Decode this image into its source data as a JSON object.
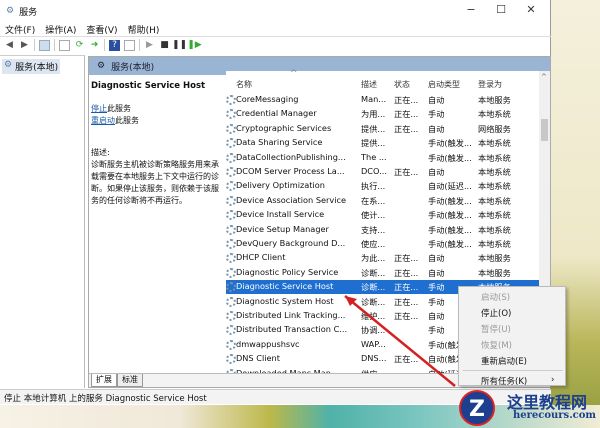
{
  "window": {
    "title": "服务",
    "minimize": "−",
    "maximize": "☐",
    "close": "✕"
  },
  "menu": [
    "文件(F)",
    "操作(A)",
    "查看(V)",
    "帮助(H)"
  ],
  "toolbar_icons": [
    "back-icon",
    "forward-icon",
    "console-tree-icon",
    "properties-icon",
    "refresh-icon",
    "export-icon",
    "help-icon",
    "view-icon",
    "start-icon",
    "stop-icon",
    "pause-icon",
    "restart-icon"
  ],
  "left_tree": {
    "item": "服务(本地)"
  },
  "panel_header": "服务(本地)",
  "details": {
    "title": "Diagnostic Service Host",
    "stop_link": "停止",
    "stop_suffix": "此服务",
    "restart_link": "重启动",
    "restart_suffix": "此服务",
    "desc_label": "描述:",
    "description": "诊断服务主机被诊断策略服务用来承载需要在本地服务上下文中运行的诊断。如果停止该服务，则依赖于该服务的任何诊断将不再运行。"
  },
  "columns": [
    "名称",
    "描述",
    "状态",
    "启动类型",
    "登录为"
  ],
  "rows": [
    [
      "CoreMessaging",
      "Man...",
      "正在...",
      "自动",
      "本地服务"
    ],
    [
      "Credential Manager",
      "为用...",
      "正在...",
      "手动",
      "本地系统"
    ],
    [
      "Cryptographic Services",
      "提供...",
      "正在...",
      "自动",
      "网络服务"
    ],
    [
      "Data Sharing Service",
      "提供...",
      "",
      "手动(触发...",
      "本地系统"
    ],
    [
      "DataCollectionPublishing...",
      "The ...",
      "",
      "手动(触发...",
      "本地系统"
    ],
    [
      "DCOM Server Process La...",
      "DCO...",
      "正在...",
      "自动",
      "本地系统"
    ],
    [
      "Delivery Optimization",
      "执行...",
      "",
      "自动(延迟...",
      "本地系统"
    ],
    [
      "Device Association Service",
      "在系...",
      "",
      "手动(触发...",
      "本地系统"
    ],
    [
      "Device Install Service",
      "使计...",
      "",
      "手动(触发...",
      "本地系统"
    ],
    [
      "Device Setup Manager",
      "支持...",
      "",
      "手动(触发...",
      "本地系统"
    ],
    [
      "DevQuery Background D...",
      "使应...",
      "",
      "手动(触发...",
      "本地系统"
    ],
    [
      "DHCP Client",
      "为此...",
      "正在...",
      "自动",
      "本地服务"
    ],
    [
      "Diagnostic Policy Service",
      "诊断...",
      "正在...",
      "自动",
      "本地服务"
    ],
    [
      "Diagnostic Service Host",
      "诊断...",
      "正在...",
      "手动",
      "本地服务"
    ],
    [
      "Diagnostic System Host",
      "诊断...",
      "正在...",
      "手动",
      ""
    ],
    [
      "Distributed Link Tracking...",
      "维护...",
      "正在...",
      "自动",
      ""
    ],
    [
      "Distributed Transaction C...",
      "协调...",
      "",
      "手动",
      ""
    ],
    [
      "dmwappushsvc",
      "WAP...",
      "",
      "手动(触发",
      ""
    ],
    [
      "DNS Client",
      "DNS...",
      "正在...",
      "自动(触发",
      ""
    ],
    [
      "Downloaded Maps Man...",
      "供应...",
      "",
      "自动(延迟",
      ""
    ]
  ],
  "selected_row": 13,
  "tabs": [
    "扩展",
    "标准"
  ],
  "status": "停止 本地计算机 上的服务 Diagnostic Service Host",
  "context_menu": [
    {
      "label": "启动(S)",
      "enabled": false
    },
    {
      "label": "停止(O)",
      "enabled": true
    },
    {
      "label": "暂停(U)",
      "enabled": false
    },
    {
      "label": "恢复(M)",
      "enabled": false
    },
    {
      "label": "重新启动(E)",
      "enabled": true
    },
    {
      "label": "所有任务(K)",
      "enabled": true,
      "submenu": "›"
    }
  ],
  "watermark": {
    "letter": "Z",
    "name": "这里教程网",
    "url": "herecours.com"
  },
  "colors": {
    "selection": "#1f6fd0",
    "header": "#9ab4d4",
    "link": "#1a5aa8",
    "arrow": "#d42020"
  }
}
